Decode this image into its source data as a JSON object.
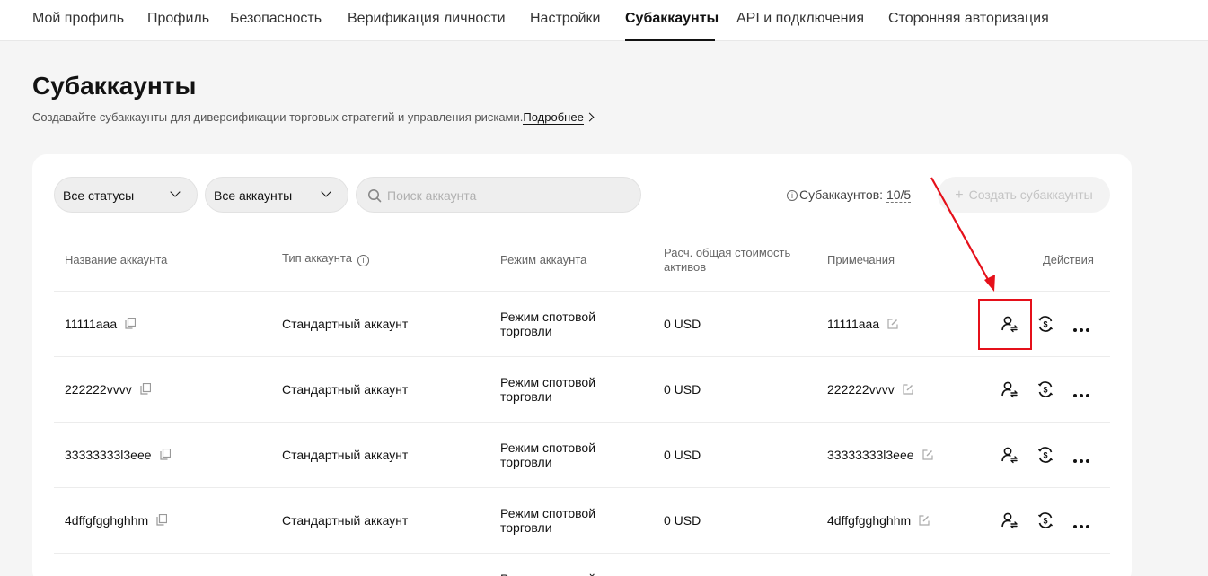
{
  "nav": {
    "tabs": [
      {
        "label": "Мой профиль"
      },
      {
        "label": "Профиль"
      },
      {
        "label": "Безопасность"
      },
      {
        "label": "Верификация личности"
      },
      {
        "label": "Настройки"
      },
      {
        "label": "Субаккаунты"
      },
      {
        "label": "API и подключения"
      },
      {
        "label": "Сторонняя авторизация"
      }
    ],
    "active": "Субаккаунты"
  },
  "page": {
    "title": "Субаккаунты",
    "subtitle": "Создавайте субаккаунты для диверсификации торговых стратегий и управления рисками.",
    "more_link": "Подробнее"
  },
  "filters": {
    "status": "Все статусы",
    "accounts": "Все аккаунты",
    "search_placeholder": "Поиск аккаунта",
    "count_label": "Субаккаунтов:",
    "count_value": "10/5",
    "create_button": "Создать субаккаунты"
  },
  "table": {
    "headers": {
      "name": "Название аккаунта",
      "type": "Тип аккаунта",
      "mode": "Режим аккаунта",
      "value": "Расч. общая стоимость активов",
      "notes": "Примечания",
      "actions": "Действия"
    },
    "rows": [
      {
        "name": "11111aaa",
        "type": "Стандартный аккаунт",
        "mode": "Режим спотовой торговли",
        "value": "0 USD",
        "note": "11111aaa"
      },
      {
        "name": "222222vvvv",
        "type": "Стандартный аккаунт",
        "mode": "Режим спотовой торговли",
        "value": "0 USD",
        "note": "222222vvvv"
      },
      {
        "name": "33333333l3eee",
        "type": "Стандартный аккаунт",
        "mode": "Режим спотовой торговли",
        "value": "0 USD",
        "note": "33333333l3eee"
      },
      {
        "name": "4dffgfgghghhm",
        "type": "Стандартный аккаунт",
        "mode": "Режим спотовой торговли",
        "value": "0 USD",
        "note": "4dffgfgghghhm"
      },
      {
        "name": "",
        "type": "",
        "mode": "Режим спотовой торговли",
        "value": "",
        "note": ""
      }
    ]
  },
  "annotation": {
    "color": "#e5101a",
    "target": "transfer-user-icon"
  }
}
